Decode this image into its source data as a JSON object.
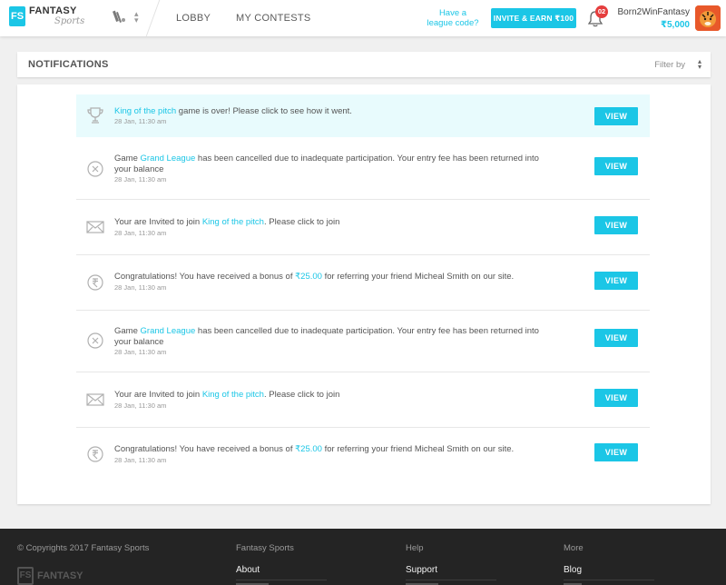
{
  "header": {
    "logo_mark": "FS",
    "logo_line1": "FANTASY",
    "logo_line2": "Sports",
    "nav": {
      "lobby": "LOBBY",
      "my_contests": "MY CONTESTS"
    },
    "league_code_line1": "Have a",
    "league_code_line2": "league code?",
    "invite_label": "INVITE & EARN ₹100",
    "notification_count": "02",
    "username": "Born2WinFantasy",
    "balance": "₹5,000",
    "accent_color": "#1bc6e6"
  },
  "notifications": {
    "title": "NOTIFICATIONS",
    "filter_label": "Filter by",
    "items": [
      {
        "icon": "trophy-icon",
        "pre": "",
        "link": "King of the pitch",
        "post": " game is over! Please click to see how it went.",
        "time": "28 Jan, 11:30 am",
        "action": "VIEW",
        "highlighted": true
      },
      {
        "icon": "cancel-icon",
        "pre": "Game ",
        "link": "Grand League",
        "post": " has been cancelled due to inadequate participation. Your entry fee has been returned into your balance",
        "time": "28 Jan, 11:30 am",
        "action": "VIEW",
        "highlighted": false
      },
      {
        "icon": "envelope-icon",
        "pre": "Your are Invited to join ",
        "link": "King of the pitch",
        "post": ". Please click to join",
        "time": "28 Jan, 11:30 am",
        "action": "VIEW",
        "highlighted": false
      },
      {
        "icon": "rupee-icon",
        "pre": "Congratulations! You have received a bonus of ",
        "link": "₹25.00",
        "post": " for referring your friend Micheal Smith on our site.",
        "time": "28 Jan, 11:30 am",
        "action": "VIEW",
        "highlighted": false
      },
      {
        "icon": "cancel-icon",
        "pre": "Game ",
        "link": "Grand League",
        "post": " has been cancelled due to inadequate participation. Your entry fee has been returned into your balance",
        "time": "28 Jan, 11:30 am",
        "action": "VIEW",
        "highlighted": false
      },
      {
        "icon": "envelope-icon",
        "pre": "Your are Invited to join ",
        "link": "King of the pitch",
        "post": ". Please click to join",
        "time": "28 Jan, 11:30 am",
        "action": "VIEW",
        "highlighted": false
      },
      {
        "icon": "rupee-icon",
        "pre": "Congratulations! You have received a bonus of ",
        "link": "₹25.00",
        "post": " for referring your friend Micheal Smith on our site.",
        "time": "28 Jan, 11:30 am",
        "action": "VIEW",
        "highlighted": false
      }
    ]
  },
  "footer": {
    "copyright": "© Copyrights 2017 Fantasy Sports",
    "logo_text": "FANTASY",
    "columns": [
      {
        "title": "Fantasy Sports",
        "link": "About"
      },
      {
        "title": "Help",
        "link": "Support"
      },
      {
        "title": "More",
        "link": "Blog"
      }
    ]
  }
}
